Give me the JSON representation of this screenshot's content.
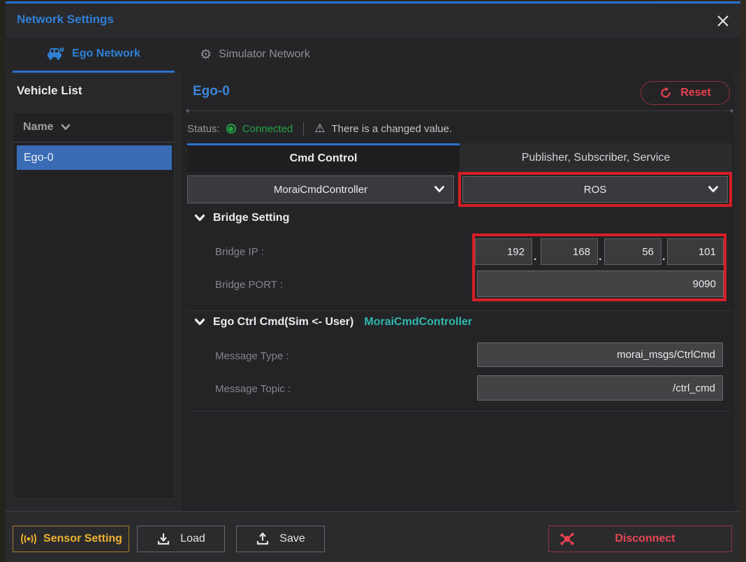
{
  "window": {
    "title": "Network Settings"
  },
  "tabs": {
    "ego": {
      "label": "Ego Network",
      "icon": "car-icon",
      "active": true
    },
    "simulator": {
      "label": "Simulator Network",
      "icon": "gear-icon",
      "active": false
    }
  },
  "sidebar": {
    "title": "Vehicle List",
    "column_header": "Name",
    "items": [
      {
        "name": "Ego-0",
        "selected": true
      }
    ]
  },
  "main": {
    "title": "Ego-0",
    "reset_label": "Reset",
    "status": {
      "label": "Status:",
      "value": "Connected",
      "warning_icon": "warning-triangle-icon",
      "warning_text": "There is a changed value."
    },
    "subtabs": {
      "left": {
        "label": "Cmd Control",
        "active": true
      },
      "right": {
        "label": "Publisher, Subscriber, Service",
        "active": false
      }
    },
    "cmd_controller_dropdown": {
      "value": "MoraiCmdController"
    },
    "network_dropdown": {
      "value": "ROS",
      "highlighted": true
    },
    "bridge": {
      "section_title": "Bridge Setting",
      "ip_label": "Bridge IP :",
      "ip_octets": [
        "192",
        "168",
        "56",
        "101"
      ],
      "ip_separator": ".",
      "port_label": "Bridge PORT :",
      "port_value": "9090",
      "highlighted": true
    },
    "ego_ctrl": {
      "section_title": "Ego Ctrl Cmd(Sim <- User)",
      "controller": "MoraiCmdController",
      "type_label": "Message Type :",
      "type_value": "morai_msgs/CtrlCmd",
      "topic_label": "Message Topic :",
      "topic_value": "/ctrl_cmd"
    }
  },
  "footer": {
    "sensor_setting_label": "Sensor Setting",
    "load_label": "Load",
    "save_label": "Save",
    "disconnect_label": "Disconnect"
  },
  "colors": {
    "accent_blue": "#2f80d4",
    "status_green": "#25a244",
    "highlight_red": "#d81e25",
    "button_red": "#e8414e",
    "teal": "#2fb8ab",
    "gold": "#ecb22e",
    "selected_row_blue": "#3a6cb6"
  }
}
